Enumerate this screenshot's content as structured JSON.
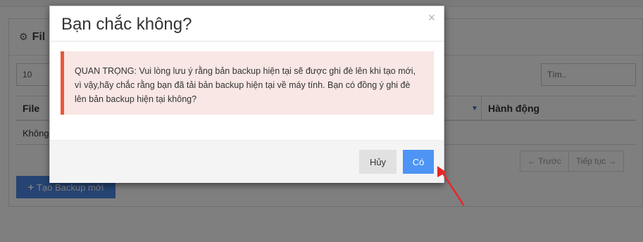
{
  "background": {
    "panel_title": "Fil",
    "page_length_value": "10",
    "search_placeholder": "Tìm..",
    "table": {
      "columns": [
        "File",
        "Hành động"
      ],
      "empty_row_text": "Không"
    },
    "pager": {
      "prev_label": "← Trước",
      "next_label": "Tiếp tục →"
    },
    "create_button_label": "Tạo Backup mới"
  },
  "modal": {
    "title": "Bạn chắc không?",
    "close_symbol": "×",
    "message": "QUAN TRỌNG: Vui lòng lưu ý rằng bản backup hiện tại sẽ được ghi đè lên khi tạo mới, vì vậy,hãy chắc rằng bạn đã tải bản backup hiện tại về máy tính. Bạn có đồng ý ghi đè lên bản backup hiện tại không?",
    "cancel_label": "Hủy",
    "confirm_label": "Có"
  },
  "colors": {
    "primary": "#4d94f5",
    "alert_background": "#f8e7e4",
    "alert_border": "#e9583a",
    "annotation_arrow": "#e8262a"
  },
  "icons": {
    "panel_header": "gears-icon",
    "sort_indicator": "sort-down-icon",
    "create_button": "plus-icon",
    "annotation": "red-arrow-icon"
  }
}
